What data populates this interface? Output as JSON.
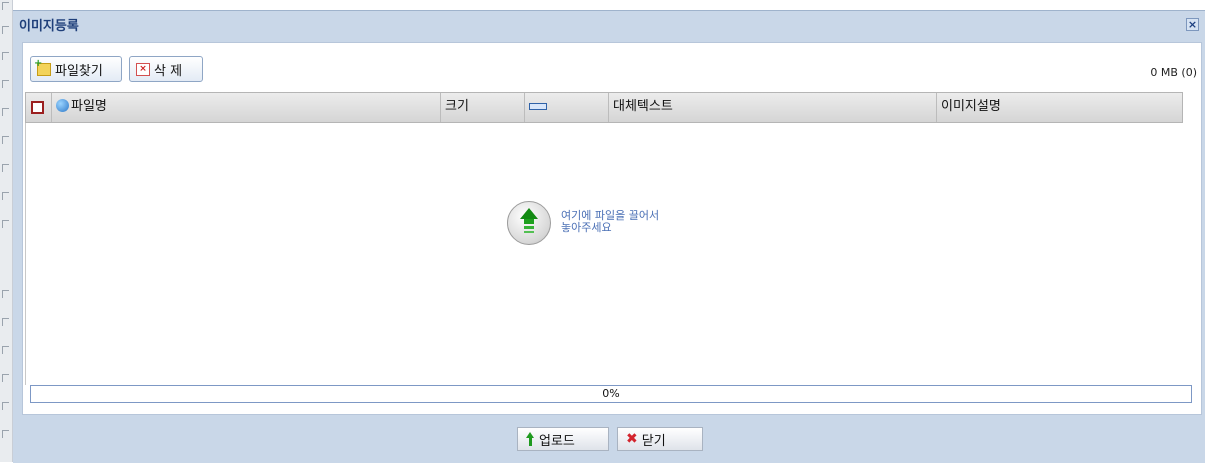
{
  "dialog": {
    "title": "이미지등록",
    "close_icon": "×"
  },
  "toolbar": {
    "find_label": "파일찾기",
    "delete_label": "삭 제",
    "size_info": "0 MB (0)"
  },
  "grid": {
    "columns": {
      "filename": "파일명",
      "size": "크기",
      "alt_text": "대체텍스트",
      "description": "이미지설명"
    }
  },
  "dropzone": {
    "line1": "여기에 파일을 끌어서",
    "line2": "놓아주세요"
  },
  "progress": {
    "value": 0,
    "label": "0%"
  },
  "footer": {
    "upload_label": "업로드",
    "close_label": "닫기"
  }
}
